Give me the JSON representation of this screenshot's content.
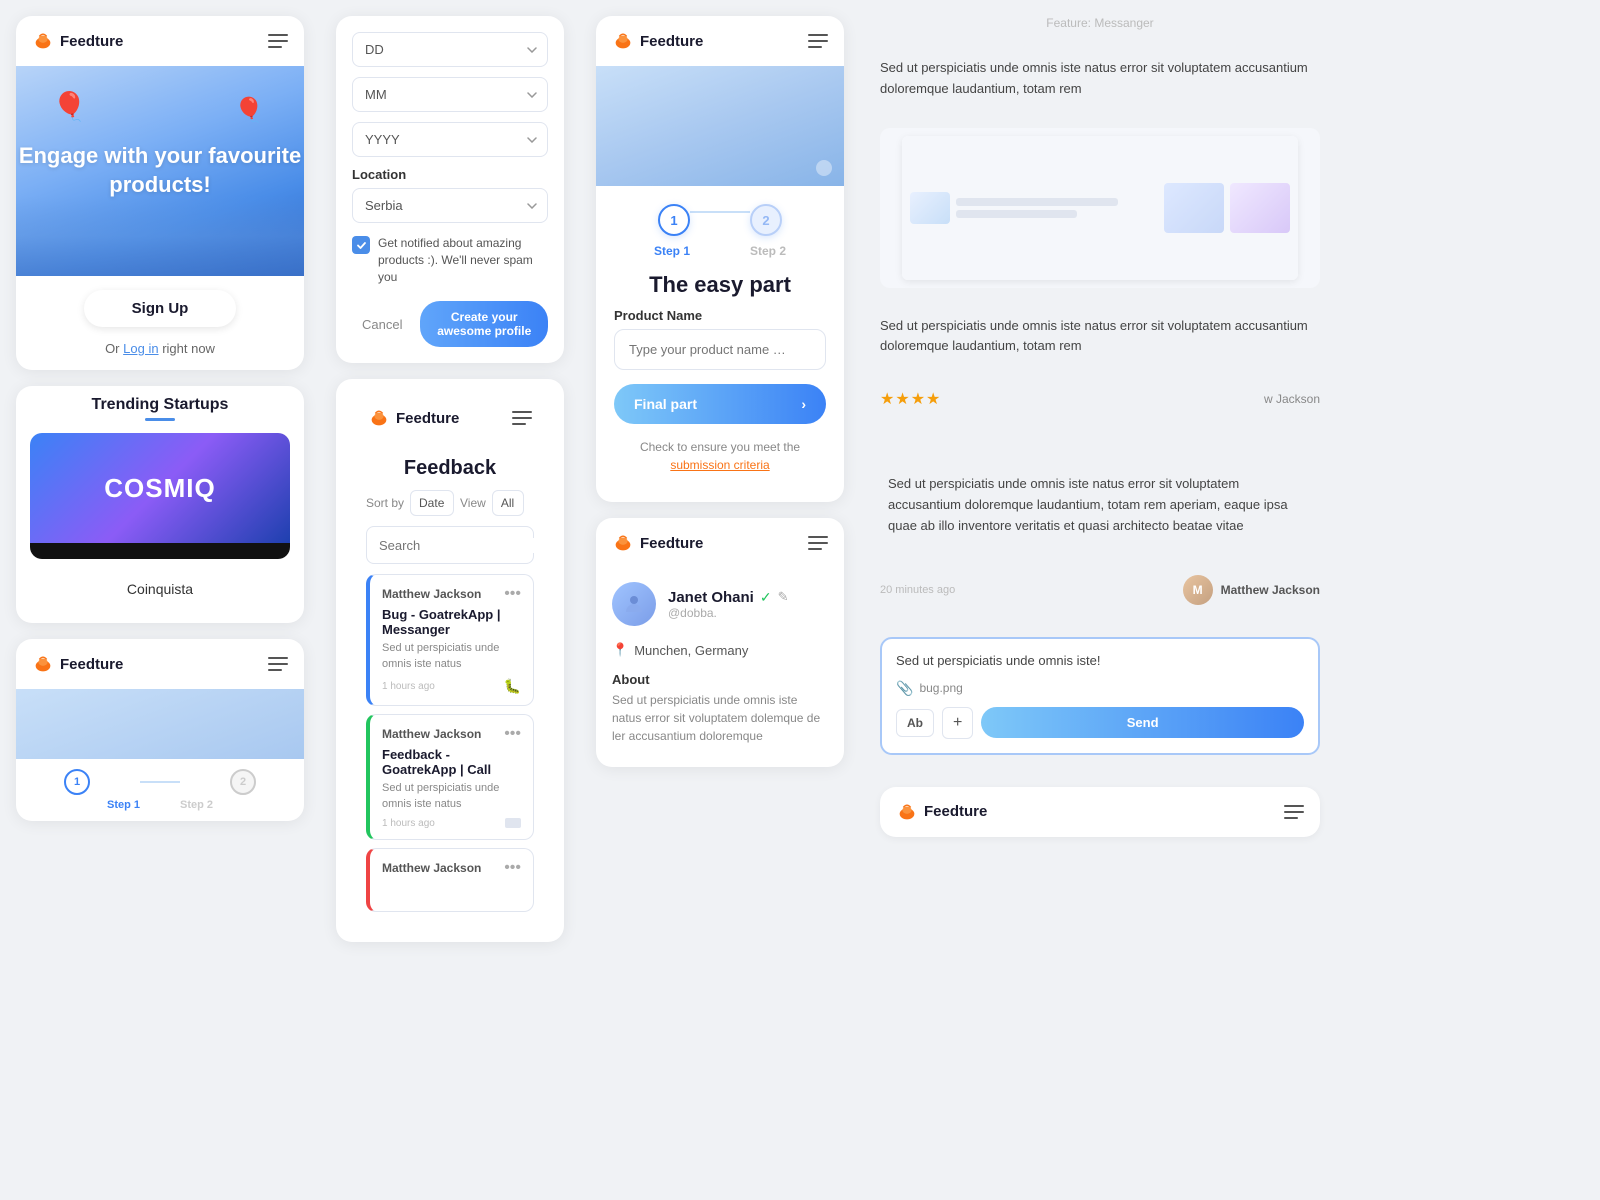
{
  "app": {
    "name": "Feedture",
    "tagline": "Engage with your favourite products!",
    "signup_btn": "Sign Up",
    "or_text": "Or",
    "login_link": "Log in",
    "login_suffix": "right now",
    "trending_title": "Trending Startups",
    "startup_name": "Coinquista",
    "startup_brand": "COSMIQ"
  },
  "form": {
    "dd_placeholder": "DD",
    "mm_placeholder": "MM",
    "yyyy_placeholder": "YYYY",
    "location_label": "Location",
    "location_value": "Serbia",
    "checkbox_text": "Get notified about amazing products :). We'll never spam you",
    "cancel_btn": "Cancel",
    "create_btn": "Create your awesome profile"
  },
  "feedback": {
    "title": "Feedback",
    "sort_label": "Sort by",
    "sort_value": "Date",
    "view_label": "View",
    "view_value": "All",
    "search_placeholder": "Search",
    "items": [
      {
        "author": "Matthew Jackson",
        "title": "Bug - GoatrekApp | Messanger",
        "body": "Sed ut perspiciatis unde omnis iste natus",
        "time": "1 hours ago",
        "type": "bug",
        "color": "blue"
      },
      {
        "author": "Matthew Jackson",
        "title": "Feedback - GoatrekApp | Call",
        "body": "Sed ut perspiciatis unde omnis iste natus",
        "time": "1 hours ago",
        "type": "feedback",
        "color": "green"
      },
      {
        "author": "Matthew Jackson",
        "title": "...",
        "body": "",
        "time": "",
        "type": "",
        "color": "red"
      }
    ]
  },
  "step_wizard": {
    "step1_label": "Step 1",
    "step2_label": "Step 2",
    "step1_num": "1",
    "step2_num": "2",
    "title": "The easy part",
    "product_label": "Product Name",
    "product_placeholder": "Type your product name …",
    "final_btn": "Final part",
    "submission_text": "Check to ensure you meet the",
    "submission_link": "submission criteria"
  },
  "profile": {
    "name": "Janet Ohani",
    "handle": "@dobba.",
    "location": "Munchen, Germany",
    "about_title": "About",
    "about_text": "Sed ut perspiciatis unde omnis iste natus error sit voluptatem dolemque de ler accusantium doloremque"
  },
  "mini_step": {
    "step1_num": "1",
    "step2_num": "2",
    "step1_label": "Step 1",
    "step2_label": "Step 2"
  },
  "right_panel": {
    "feature_label": "Feature: Messanger",
    "review1": "Sed ut perspiciatis unde omnis iste natus error sit voluptatem accusantium doloremque laudantium, totam rem",
    "review2": "Sed ut perspiciatis unde omnis iste natus error sit voluptatem accusantium doloremque laudantium, totam rem",
    "review3": "Sed ut perspiciatis unde omnis iste natus error sit voluptatem accusantium doloremque laudantium, totam rem aperiam, eaque ipsa quae ab illo inventore veritatis et quasi architecto beatae vitae",
    "stars": "★★★★",
    "reviewer": "w Jackson",
    "time": "20 minutes ago",
    "reviewer_name": "Matthew Jackson",
    "message_text": "Sed ut perspiciatis unde omnis iste!",
    "attachment": "bug.png",
    "ab_btn": "Ab",
    "plus_btn": "+",
    "send_btn": "Send"
  }
}
